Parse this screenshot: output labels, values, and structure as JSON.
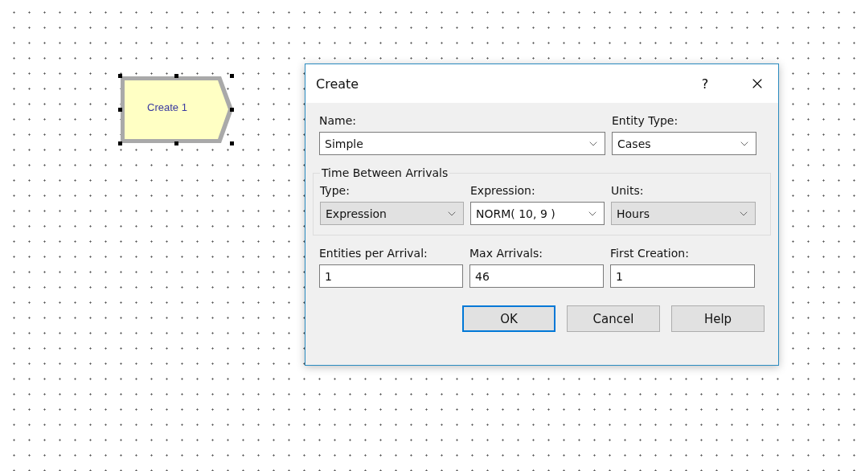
{
  "canvas": {
    "module": {
      "label": "Create 1",
      "selected": true
    }
  },
  "dialog": {
    "title": "Create",
    "help_glyph": "?",
    "top_fields": [
      {
        "label": "Name:",
        "value": "Simple",
        "kind": "combo",
        "editable": true
      },
      {
        "label": "Entity Type:",
        "value": "Cases",
        "kind": "combo",
        "editable": true
      }
    ],
    "group": {
      "title": "Time Between Arrivals",
      "fields": [
        {
          "label": "Type:",
          "value": "Expression",
          "kind": "combo",
          "editable": false
        },
        {
          "label": "Expression:",
          "value": "NORM( 10, 9 )",
          "kind": "combo",
          "editable": true
        },
        {
          "label": "Units:",
          "value": "Hours",
          "kind": "combo",
          "editable": false
        }
      ]
    },
    "bottom_fields": [
      {
        "label": "Entities per Arrival:",
        "value": "1",
        "kind": "text"
      },
      {
        "label": "Max Arrivals:",
        "value": "46",
        "kind": "text"
      },
      {
        "label": "First Creation:",
        "value": "1",
        "kind": "text"
      }
    ],
    "buttons": [
      {
        "label": "OK",
        "default": true
      },
      {
        "label": "Cancel",
        "default": false
      },
      {
        "label": "Help",
        "default": false
      }
    ]
  }
}
